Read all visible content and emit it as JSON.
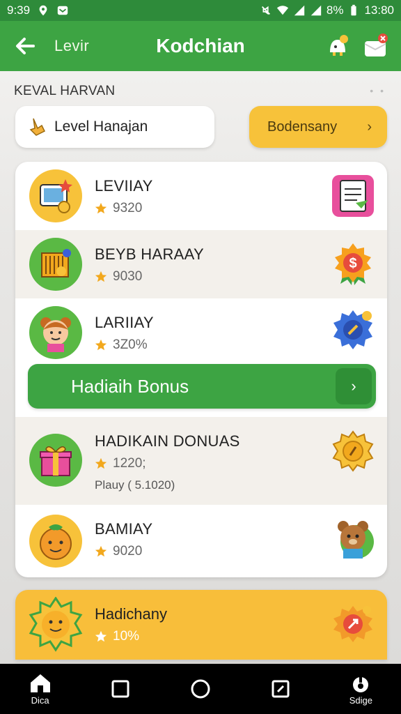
{
  "status_bar": {
    "time": "9:39",
    "battery": "8%",
    "clock": "13:80"
  },
  "app_bar": {
    "subtitle": "Levir",
    "title": "Kodchian"
  },
  "section": {
    "label": "KEVAL HARVAN"
  },
  "selector": {
    "label": "Level Hanajan"
  },
  "action_button": {
    "label": "Bodensany"
  },
  "rows": [
    {
      "title": "LEVIIAY",
      "score": "9320"
    },
    {
      "title": "BEYB HARAAY",
      "score": "9030"
    },
    {
      "title": "LARIIAY",
      "score": "3Z0%"
    },
    {
      "title": "HADIKAIN DONUAS",
      "score": "1220;",
      "sub": "Plauy ( 5.1020)"
    },
    {
      "title": "BAMIAY",
      "score": "9020"
    }
  ],
  "bonus_button": {
    "label": "Hadiaih Bonus"
  },
  "bottom_card": {
    "title": "Hadichany",
    "score": "10%"
  },
  "navbar": {
    "items": [
      {
        "label": "Dica"
      },
      {
        "label": ""
      },
      {
        "label": ""
      },
      {
        "label": ""
      },
      {
        "label": "Sdige"
      }
    ]
  },
  "colors": {
    "primary_green": "#3da443",
    "accent_yellow": "#f7c23a"
  }
}
